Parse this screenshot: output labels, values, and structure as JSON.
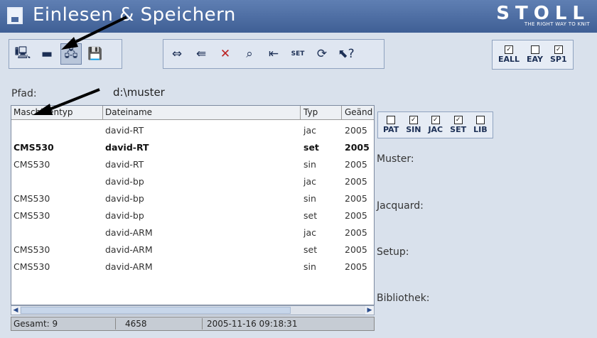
{
  "header": {
    "title": "Einlesen & Speichern",
    "brand": "STOLL",
    "tagline": "THE RIGHT WAY TO KNIT"
  },
  "toolbar": {
    "group1": [
      "computer-icon",
      "drive-icon",
      "network-drive-icon",
      "save-to-disk-icon"
    ],
    "group2": [
      "load-icon",
      "load-left-icon",
      "delete-icon",
      "search-icon",
      "import-icon",
      "set-edit-icon",
      "refresh-icon",
      "help-icon"
    ],
    "set_label": "SET"
  },
  "top_filters": [
    {
      "label": "EALL",
      "checked": true
    },
    {
      "label": "EAY",
      "checked": false
    },
    {
      "label": "SP1",
      "checked": true
    }
  ],
  "path": {
    "label": "Pfad:",
    "value": "d:\\muster"
  },
  "table": {
    "columns": [
      "Maschinentyp",
      "Dateiname",
      "Typ",
      "Geänd"
    ],
    "rows": [
      {
        "machine": "",
        "file": "david-RT",
        "type": "jac",
        "date": "2005",
        "bold": false
      },
      {
        "machine": "CMS530",
        "file": "david-RT",
        "type": "set",
        "date": "2005",
        "bold": true
      },
      {
        "machine": "CMS530",
        "file": "david-RT",
        "type": "sin",
        "date": "2005",
        "bold": false
      },
      {
        "machine": "",
        "file": "david-bp",
        "type": "jac",
        "date": "2005",
        "bold": false
      },
      {
        "machine": "CMS530",
        "file": "david-bp",
        "type": "sin",
        "date": "2005",
        "bold": false
      },
      {
        "machine": "CMS530",
        "file": "david-bp",
        "type": "set",
        "date": "2005",
        "bold": false
      },
      {
        "machine": "",
        "file": "david-ARM",
        "type": "jac",
        "date": "2005",
        "bold": false
      },
      {
        "machine": "CMS530",
        "file": "david-ARM",
        "type": "set",
        "date": "2005",
        "bold": false
      },
      {
        "machine": "CMS530",
        "file": "david-ARM",
        "type": "sin",
        "date": "2005",
        "bold": false
      }
    ]
  },
  "status": {
    "total": "Gesamt:  9",
    "size": "4658",
    "datetime": "2005-11-16 09:18:31"
  },
  "type_filters": [
    {
      "label": "PAT",
      "checked": false
    },
    {
      "label": "SIN",
      "checked": true
    },
    {
      "label": "JAC",
      "checked": true
    },
    {
      "label": "SET",
      "checked": true
    },
    {
      "label": "LIB",
      "checked": false
    }
  ],
  "info": {
    "muster": "Muster:",
    "jacquard": "Jacquard:",
    "setup": "Setup:",
    "bibliothek": "Bibliothek:"
  }
}
